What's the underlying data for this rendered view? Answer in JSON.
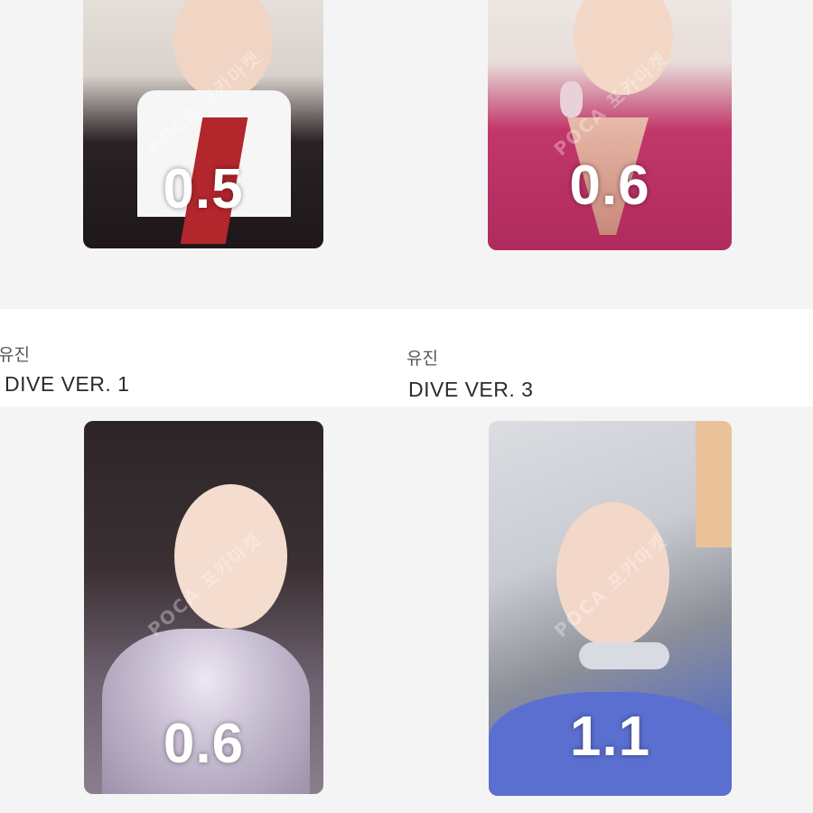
{
  "listings": [
    {
      "price": "0.5",
      "watermark": "POCA 포카마켓"
    },
    {
      "price": "0.6",
      "watermark": "POCA 포카마켓"
    },
    {
      "member": "유진",
      "title": "DIVE VER. 1",
      "price": "0.6",
      "watermark": "POCA 포카마켓"
    },
    {
      "member": "유진",
      "title": "DIVE VER. 3",
      "price": "1.1",
      "watermark": "POCA 포카마켓"
    }
  ]
}
